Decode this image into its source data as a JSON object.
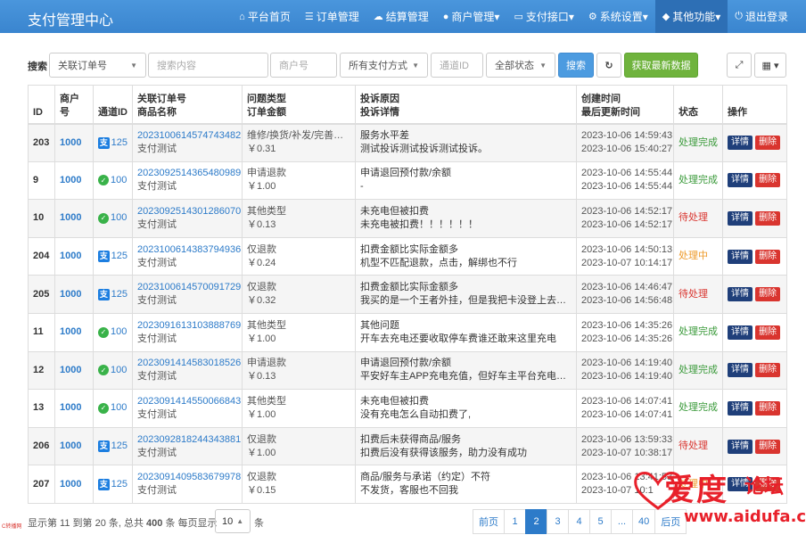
{
  "app": {
    "title": "支付管理中心"
  },
  "nav": [
    {
      "icon": "home-icon",
      "glyph": "⌂",
      "label": "平台首页"
    },
    {
      "icon": "list-icon",
      "glyph": "☰",
      "label": "订单管理"
    },
    {
      "icon": "cloud-icon",
      "glyph": "☁",
      "label": "结算管理"
    },
    {
      "icon": "user-icon",
      "glyph": "●",
      "label": "商户管理▾"
    },
    {
      "icon": "card-icon",
      "glyph": "▭",
      "label": "支付接口▾"
    },
    {
      "icon": "gear-icon",
      "glyph": "⚙",
      "label": "系统设置▾"
    },
    {
      "icon": "cube-icon",
      "glyph": "◆",
      "label": "其他功能▾"
    },
    {
      "icon": "power-icon",
      "glyph": "⏻",
      "label": "退出登录"
    }
  ],
  "toolbar": {
    "search_label": "搜索",
    "field_select": "关联订单号",
    "search_placeholder": "搜索内容",
    "merchant_placeholder": "商户号",
    "paytype_select": "所有支付方式",
    "channel_placeholder": "通道ID",
    "status_select": "全部状态",
    "search_button": "搜索",
    "refresh_glyph": "↻",
    "fetch_button": "获取最新数据",
    "fullscreen_glyph": "⤢",
    "columns_glyph": "▦ ▾"
  },
  "table": {
    "headers": {
      "id": "ID",
      "merchant": "商户号",
      "channel": "通道ID",
      "order_1": "关联订单号",
      "order_2": "商品名称",
      "type_1": "问题类型",
      "type_2": "订单金额",
      "reason_1": "投诉原因",
      "reason_2": "投诉详情",
      "time_1": "创建时间",
      "time_2": "最后更新时间",
      "status": "状态",
      "action": "操作"
    },
    "detail_label": "详情",
    "delete_label": "删除",
    "rows": [
      {
        "id": "203",
        "merchant": "1000",
        "pay": "alipay",
        "channel": "125",
        "order": "2023100614574743482",
        "product": "支付测试",
        "type": "维修/换货/补发/完善服务",
        "amount": "￥0.31",
        "reason": "服务水平差",
        "detail": "测试投诉测试投诉测试投诉。",
        "created": "2023-10-06 14:59:43",
        "updated": "2023-10-06 15:40:27",
        "status": "处理完成",
        "status_kind": "done"
      },
      {
        "id": "9",
        "merchant": "1000",
        "pay": "wechat",
        "channel": "100",
        "order": "2023092514365480989",
        "product": "支付测试",
        "type": "申请退款",
        "amount": "￥1.00",
        "reason": "申请退回预付款/余额",
        "detail": "-",
        "created": "2023-10-06 14:55:44",
        "updated": "2023-10-06 14:55:44",
        "status": "处理完成",
        "status_kind": "done"
      },
      {
        "id": "10",
        "merchant": "1000",
        "pay": "wechat",
        "channel": "100",
        "order": "2023092514301286070",
        "product": "支付测试",
        "type": "其他类型",
        "amount": "￥0.13",
        "reason": "未充电但被扣费",
        "detail": "未充电被扣费！！！！！！",
        "created": "2023-10-06 14:52:17",
        "updated": "2023-10-06 14:52:17",
        "status": "待处理",
        "status_kind": "pending"
      },
      {
        "id": "204",
        "merchant": "1000",
        "pay": "alipay",
        "channel": "125",
        "order": "2023100614383794936",
        "product": "支付测试",
        "type": "仅退款",
        "amount": "￥0.24",
        "reason": "扣费金额比实际金额多",
        "detail": "机型不匹配退款，点击，解绑也不行",
        "created": "2023-10-06 14:50:13",
        "updated": "2023-10-07 10:14:17",
        "status": "处理中",
        "status_kind": "doing"
      },
      {
        "id": "205",
        "merchant": "1000",
        "pay": "alipay",
        "channel": "125",
        "order": "2023100614570091729",
        "product": "支付测试",
        "type": "仅退款",
        "amount": "￥0.32",
        "reason": "扣费金额比实际金额多",
        "detail": "我买的是一个王者外挂，但是我把卡没登上去，...",
        "created": "2023-10-06 14:46:47",
        "updated": "2023-10-06 14:56:48",
        "status": "待处理",
        "status_kind": "pending"
      },
      {
        "id": "11",
        "merchant": "1000",
        "pay": "wechat",
        "channel": "100",
        "order": "2023091613103888769",
        "product": "支付测试",
        "type": "其他类型",
        "amount": "￥1.00",
        "reason": "其他问题",
        "detail": "开车去充电还要收取停车费谁还敢来这里充电",
        "created": "2023-10-06 14:35:26",
        "updated": "2023-10-06 14:35:26",
        "status": "处理完成",
        "status_kind": "done"
      },
      {
        "id": "12",
        "merchant": "1000",
        "pay": "wechat",
        "channel": "100",
        "order": "2023091414583018526",
        "product": "支付测试",
        "type": "申请退款",
        "amount": "￥0.13",
        "reason": "申请退回预付款/余额",
        "detail": "平安好车主APP充电充值，但好车主平台充电不...",
        "created": "2023-10-06 14:19:40",
        "updated": "2023-10-06 14:19:40",
        "status": "处理完成",
        "status_kind": "done"
      },
      {
        "id": "13",
        "merchant": "1000",
        "pay": "wechat",
        "channel": "100",
        "order": "2023091414550066843",
        "product": "支付测试",
        "type": "其他类型",
        "amount": "￥1.00",
        "reason": "未充电但被扣费",
        "detail": "没有充电怎么自动扣费了,",
        "created": "2023-10-06 14:07:41",
        "updated": "2023-10-06 14:07:41",
        "status": "处理完成",
        "status_kind": "done"
      },
      {
        "id": "206",
        "merchant": "1000",
        "pay": "alipay",
        "channel": "125",
        "order": "2023092818244343881",
        "product": "支付测试",
        "type": "仅退款",
        "amount": "￥1.00",
        "reason": "扣费后未获得商品/服务",
        "detail": "扣费后没有获得该服务，助力没有成功",
        "created": "2023-10-06 13:59:33",
        "updated": "2023-10-07 10:38:17",
        "status": "待处理",
        "status_kind": "pending"
      },
      {
        "id": "207",
        "merchant": "1000",
        "pay": "alipay",
        "channel": "125",
        "order": "2023091409583679978",
        "product": "支付测试",
        "type": "仅退款",
        "amount": "￥0.15",
        "reason": "商品/服务与承诺（约定）不符",
        "detail": "不发货，客服也不回我",
        "created": "2023-10-06 13:41:53",
        "updated": "2023-10-07 10:1",
        "status": "处理中",
        "status_kind": "doing"
      }
    ]
  },
  "footer": {
    "summary_prefix": "显示第 11 到第 20 条, 总共 ",
    "total": "400",
    "summary_mid": " 条   每页显示",
    "page_size": "10",
    "summary_suffix": "条"
  },
  "pager": [
    "前页",
    "1",
    "2",
    "3",
    "4",
    "5",
    "...",
    "40",
    "后页"
  ],
  "pager_active": "2",
  "watermark": {
    "text": "爱度",
    "small": "论坛",
    "url": "www.aidufa.cn"
  },
  "corner_text": "C转播网"
}
